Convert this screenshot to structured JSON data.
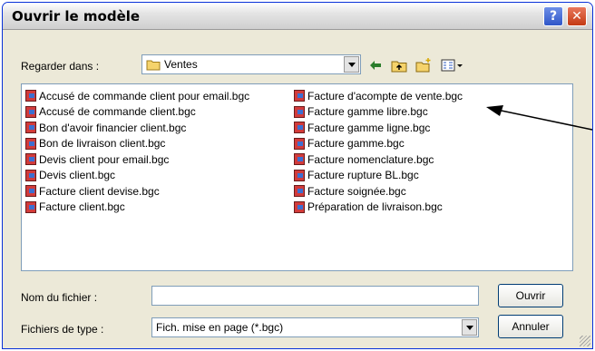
{
  "window": {
    "title": "Ouvrir le modèle",
    "help_label": "?",
    "close_label": "✕"
  },
  "look_in": {
    "label": "Regarder dans :",
    "value": "Ventes"
  },
  "toolbar": {
    "icons": [
      "back-icon",
      "up-folder-icon",
      "new-folder-icon",
      "view-menu-icon"
    ]
  },
  "files": {
    "column1": [
      "Accusé de commande client pour email.bgc",
      "Accusé de commande client.bgc",
      "Bon d'avoir financier client.bgc",
      "Bon de livraison client.bgc",
      "Devis client pour email.bgc",
      "Devis client.bgc",
      "Facture client devise.bgc",
      "Facture client.bgc"
    ],
    "column2": [
      "Facture d'acompte de vente.bgc",
      "Facture gamme libre.bgc",
      "Facture gamme ligne.bgc",
      "Facture gamme.bgc",
      "Facture nomenclature.bgc",
      "Facture rupture BL.bgc",
      "Facture soignée.bgc",
      "Préparation de livraison.bgc"
    ]
  },
  "filename": {
    "label": "Nom du fichier :",
    "value": ""
  },
  "filetype": {
    "label": "Fichiers de type :",
    "value": "Fich. mise en page (*.bgc)"
  },
  "buttons": {
    "open": "Ouvrir",
    "cancel": "Annuler"
  },
  "colors": {
    "dialog_bg": "#ece9d8",
    "border_blue": "#7f9db9"
  }
}
